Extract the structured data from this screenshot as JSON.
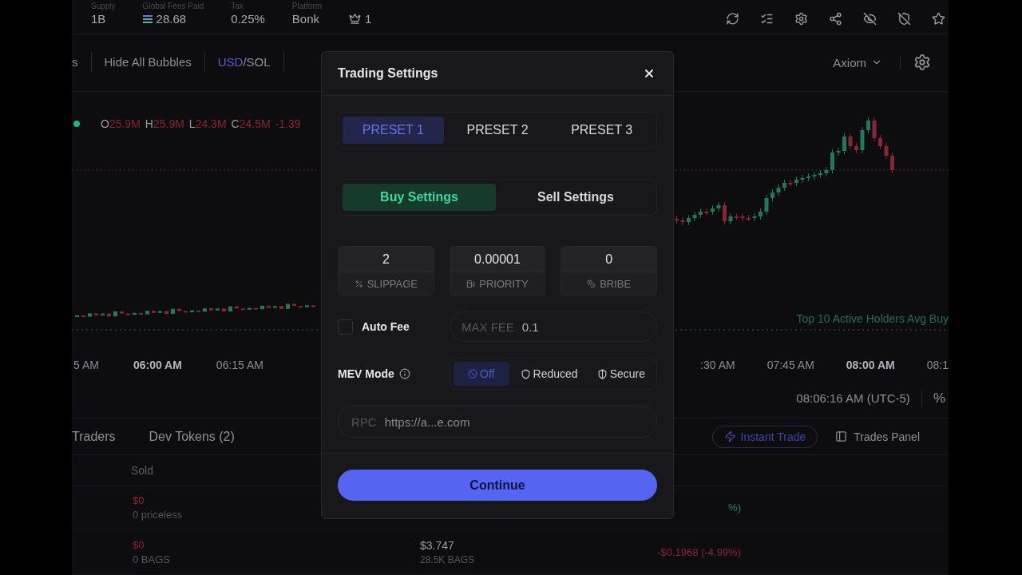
{
  "header": {
    "stats": [
      {
        "label": "Supply",
        "value": "1B",
        "kind": "plain"
      },
      {
        "label": "Global Fees Paid",
        "value": "28.68",
        "kind": "sol"
      },
      {
        "label": "Tax",
        "value": "0.25%",
        "kind": "plain"
      },
      {
        "label": "Platform",
        "value": "Bonk",
        "kind": "plain"
      }
    ],
    "crown_count": "1"
  },
  "toolbar": {
    "cut_item": "s",
    "bubbles": "Hide All Bubbles",
    "currency": [
      {
        "label": "USD",
        "selected": true
      },
      {
        "label": "SOL",
        "selected": false
      }
    ],
    "separator": "/",
    "platform": "Axiom"
  },
  "chart": {
    "legend": [
      {
        "key": "O",
        "value": "25.9M"
      },
      {
        "key": "H",
        "value": "25.9M"
      },
      {
        "key": "L",
        "value": "24.3M"
      },
      {
        "key": "C",
        "value": "24.5M"
      }
    ],
    "change": "-1.39",
    "avg_buy_label": "Top 10 Active Holders Avg Buy",
    "time_labels_left": [
      {
        "text": "5 AM",
        "bold": false
      },
      {
        "text": "06:00 AM",
        "bold": true
      },
      {
        "text": "06:15 AM",
        "bold": false
      }
    ],
    "time_labels_right": [
      {
        "text": ":30 AM",
        "bold": false
      },
      {
        "text": "07:45 AM",
        "bold": false
      },
      {
        "text": "08:00 AM",
        "bold": true
      },
      {
        "text": "08:1",
        "bold": false
      }
    ],
    "timestamp": "08:06:16 AM (UTC-5)",
    "percent": "%"
  },
  "bottom": {
    "tabs": [
      "Traders",
      "Dev Tokens (2)"
    ],
    "instant_trade": "Instant Trade",
    "trades_panel": "Trades Panel",
    "column": "Sold",
    "rows": [
      {
        "sold": "$0",
        "sold_sub": "0 priceless",
        "right": "%)",
        "color": "#1f8a63"
      },
      {
        "sold": "$0",
        "sold_sub": "0 BAGS",
        "middle": "$3.747",
        "middle_sub": "28.5K BAGS",
        "right": "-$0.1968 (-4.99%)",
        "color": "#8a2438"
      }
    ]
  },
  "modal": {
    "title": "Trading Settings",
    "presets": [
      {
        "label": "PRESET 1",
        "selected": true
      },
      {
        "label": "PRESET 2",
        "selected": false
      },
      {
        "label": "PRESET 3",
        "selected": false
      }
    ],
    "sides": [
      {
        "label": "Buy Settings",
        "selected": true
      },
      {
        "label": "Sell Settings",
        "selected": false
      }
    ],
    "fields": [
      {
        "value": "2",
        "label": "SLIPPAGE",
        "kind": "slippage"
      },
      {
        "value": "0.00001",
        "label": "PRIORITY",
        "kind": "priority"
      },
      {
        "value": "0",
        "label": "BRIBE",
        "kind": "bribe"
      }
    ],
    "auto_fee": {
      "label": "Auto Fee",
      "checked": false
    },
    "max_fee": {
      "label": "MAX FEE",
      "value": "0.1"
    },
    "mev": {
      "label": "MEV Mode",
      "options": [
        {
          "label": "Off",
          "kind": "off",
          "selected": true
        },
        {
          "label": "Reduced",
          "kind": "reduced",
          "selected": false
        },
        {
          "label": "Secure",
          "kind": "secure",
          "selected": false
        }
      ]
    },
    "rpc": {
      "label": "RPC",
      "value": "https://a...e.com"
    },
    "continue": "Continue"
  }
}
